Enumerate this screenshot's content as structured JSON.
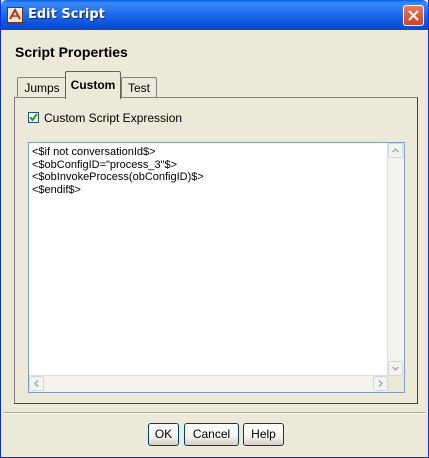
{
  "window": {
    "title": "Edit Script",
    "icon": "script-app-icon",
    "close_icon": "close-icon",
    "accent": "#0A53DA",
    "close_color": "#C84526"
  },
  "dialog": {
    "section_title": "Script Properties",
    "tabs": [
      {
        "label": "Jumps",
        "selected": false
      },
      {
        "label": "Custom",
        "selected": true
      },
      {
        "label": "Test",
        "selected": false
      }
    ],
    "custom": {
      "checkbox_label": "Custom Script Expression",
      "checkbox_checked": true,
      "script_lines": [
        "<$if not conversationId$>",
        "<$obConfigID=\"process_3\"$>",
        "<$obInvokeProcess(obConfigID)$>",
        "<$endif$>"
      ]
    },
    "buttons": {
      "ok": "OK",
      "cancel": "Cancel",
      "help": "Help"
    }
  }
}
